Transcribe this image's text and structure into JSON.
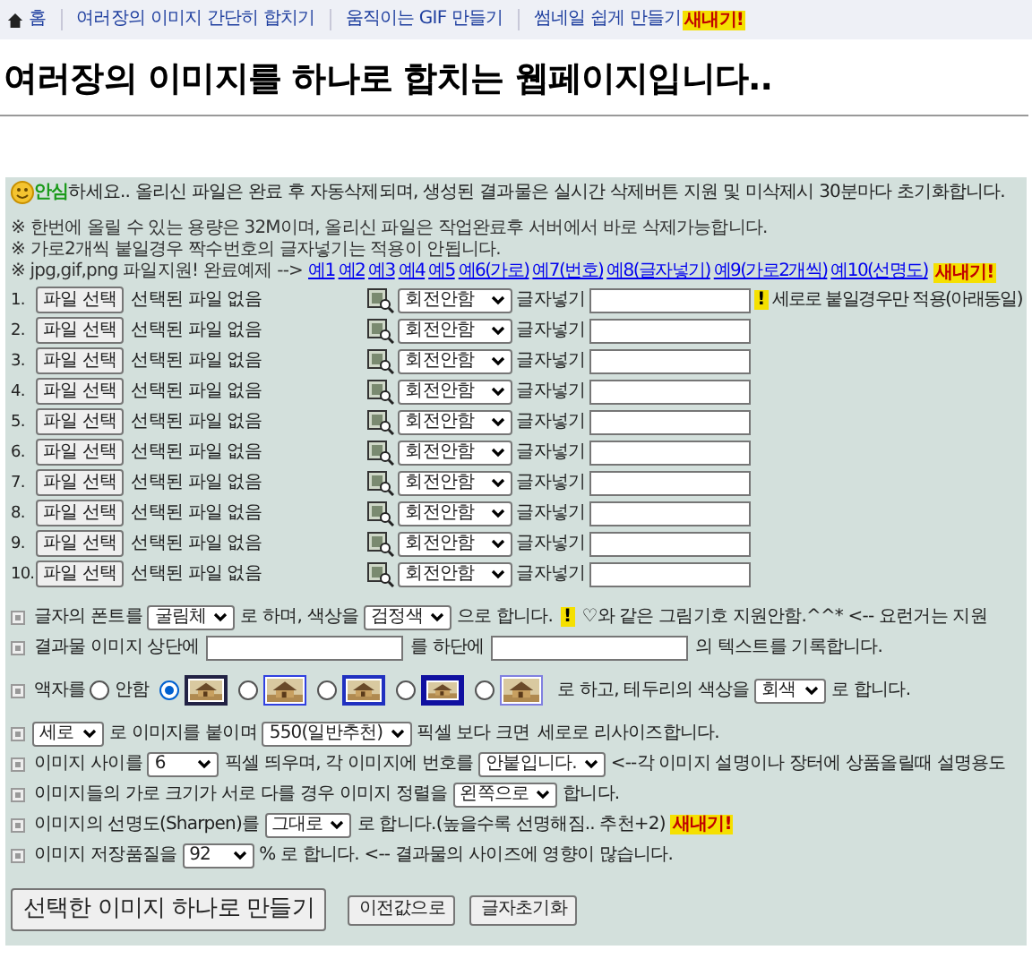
{
  "nav": [
    {
      "kind": "home",
      "label": "홈"
    },
    {
      "kind": "link",
      "label": "여러장의 이미지 간단히 합치기"
    },
    {
      "kind": "link",
      "label": "움직이는 GIF 만들기"
    },
    {
      "kind": "link",
      "label": "썸네일 쉽게 만들기",
      "badge": "새내기!"
    }
  ],
  "title": "여러장의 이미지를 하나로 합치는 웹페이지입니다..",
  "notice": {
    "highlight": "안심",
    "text": "하세요.. 올리신 파일은 완료 후 자동삭제되며, 생성된 결과물은 실시간 삭제버튼 지원 및 미삭제시 30분마다 초기화합니다."
  },
  "notes": [
    "※ 한번에 올릴 수 있는 용량은 32M이며, 올리신 파일은 작업완료후 서버에서 바로 삭제가능합니다.",
    "※ 가로2개씩 붙일경우 짝수번호의 글자넣기는 적용이 안됩니다."
  ],
  "examples": {
    "text": "※ jpg,gif,png 파일지원! 완료예제 -->",
    "links": [
      "예1",
      "예2",
      "예3",
      "예4",
      "예5",
      "예6(가로)",
      "예7(번호)",
      "예8(글자넣기)",
      "예9(가로2개씩)",
      "예10(선명도)"
    ],
    "badge": "새내기!"
  },
  "files": [
    {
      "number": "1.",
      "button": "파일 선택",
      "status": "선택된 파일 없음",
      "rotation": "회전안함",
      "text_label": "글자넣기",
      "warn": "!",
      "note": "세로로 붙일경우만 적용(아래동일)"
    },
    {
      "number": "2.",
      "button": "파일 선택",
      "status": "선택된 파일 없음",
      "rotation": "회전안함",
      "text_label": "글자넣기"
    },
    {
      "number": "3.",
      "button": "파일 선택",
      "status": "선택된 파일 없음",
      "rotation": "회전안함",
      "text_label": "글자넣기"
    },
    {
      "number": "4.",
      "button": "파일 선택",
      "status": "선택된 파일 없음",
      "rotation": "회전안함",
      "text_label": "글자넣기"
    },
    {
      "number": "5.",
      "button": "파일 선택",
      "status": "선택된 파일 없음",
      "rotation": "회전안함",
      "text_label": "글자넣기"
    },
    {
      "number": "6.",
      "button": "파일 선택",
      "status": "선택된 파일 없음",
      "rotation": "회전안함",
      "text_label": "글자넣기"
    },
    {
      "number": "7.",
      "button": "파일 선택",
      "status": "선택된 파일 없음",
      "rotation": "회전안함",
      "text_label": "글자넣기"
    },
    {
      "number": "8.",
      "button": "파일 선택",
      "status": "선택된 파일 없음",
      "rotation": "회전안함",
      "text_label": "글자넣기"
    },
    {
      "number": "9.",
      "button": "파일 선택",
      "status": "선택된 파일 없음",
      "rotation": "회전안함",
      "text_label": "글자넣기"
    },
    {
      "number": "10.",
      "button": "파일 선택",
      "status": "선택된 파일 없음",
      "rotation": "회전안함",
      "text_label": "글자넣기"
    }
  ],
  "option_groups": [
    [
      {
        "parts": [
          {
            "kind": "text",
            "text": "글자의 폰트를"
          },
          {
            "kind": "select",
            "value": "굴림체"
          },
          {
            "kind": "text",
            "text": "로 하며, 색상을"
          },
          {
            "kind": "select",
            "value": "검정색"
          },
          {
            "kind": "text",
            "text": "으로 합니다."
          },
          {
            "kind": "warn",
            "text": "!"
          },
          {
            "kind": "text",
            "text": "♡와 같은 그림기호 지원안함.^^* <-- 요런거는 지원"
          }
        ]
      },
      {
        "parts": [
          {
            "kind": "text",
            "text": "결과물 이미지 상단에"
          },
          {
            "kind": "input"
          },
          {
            "kind": "text",
            "text": "를 하단에"
          },
          {
            "kind": "input"
          },
          {
            "kind": "text",
            "text": "의 텍스트를 기록합니다."
          }
        ]
      }
    ],
    [
      {
        "parts": [
          {
            "kind": "text",
            "text": "액자를"
          },
          {
            "kind": "radio",
            "selected": false,
            "label": "안함"
          },
          {
            "kind": "frame-dark",
            "selected": true
          },
          {
            "kind": "frame-blue",
            "selected": false
          },
          {
            "kind": "frame-navy",
            "selected": false
          },
          {
            "kind": "frame-thick",
            "selected": false
          },
          {
            "kind": "frame-light",
            "selected": false
          },
          {
            "kind": "text",
            "text": "로 하고, 테두리의 색상을"
          },
          {
            "kind": "select",
            "value": "회색"
          },
          {
            "kind": "text",
            "text": "로 합니다."
          }
        ]
      }
    ],
    [
      {
        "parts": [
          {
            "kind": "select",
            "value": "세로"
          },
          {
            "kind": "text",
            "text": "로 이미지를 붙이며"
          },
          {
            "kind": "select",
            "value": "550(일반추천)"
          },
          {
            "kind": "text",
            "text": "픽셀 보다 크면"
          },
          {
            "kind": "text",
            "text": "세로로 리사이즈합니다."
          }
        ]
      },
      {
        "parts": [
          {
            "kind": "text",
            "text": "이미지 사이를"
          },
          {
            "kind": "select",
            "value": "6"
          },
          {
            "kind": "text",
            "text": "픽셀 띄우며, 각 이미지에 번호를"
          },
          {
            "kind": "select",
            "value": "안붙입니다."
          },
          {
            "kind": "text",
            "text": "<--각 이미지 설명이나 장터에 상품올릴때 설명용도"
          }
        ]
      },
      {
        "parts": [
          {
            "kind": "text",
            "text": "이미지들의 가로 크기가 서로 다를 경우 이미지 정렬을"
          },
          {
            "kind": "select",
            "value": "왼쪽으로"
          },
          {
            "kind": "text",
            "text": "합니다."
          }
        ]
      },
      {
        "parts": [
          {
            "kind": "text",
            "text": "이미지의 선명도(Sharpen)를"
          },
          {
            "kind": "select",
            "value": "그대로"
          },
          {
            "kind": "text",
            "text": "로 합니다.(높을수록 선명해짐.. 추천+2)"
          },
          {
            "kind": "badge",
            "text": "새내기!"
          }
        ]
      },
      {
        "parts": [
          {
            "kind": "text",
            "text": "이미지 저장품질을"
          },
          {
            "kind": "select",
            "value": "92"
          },
          {
            "kind": "text",
            "text": "% 로 합니다. <-- 결과물의 사이즈에 영향이 많습니다."
          }
        ]
      }
    ]
  ],
  "buttons": [
    {
      "kind": "primary",
      "label": "선택한 이미지 하나로 만들기"
    },
    {
      "kind": "secondary",
      "label": "이전값으로"
    },
    {
      "kind": "secondary",
      "label": "글자초기화"
    }
  ]
}
